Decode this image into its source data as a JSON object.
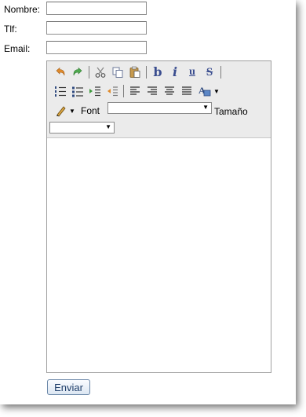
{
  "form": {
    "name_label": "Nombre:",
    "phone_label": "Tlf:",
    "email_label": "Email:",
    "name_value": "",
    "phone_value": "",
    "email_value": "",
    "submit_label": "Enviar"
  },
  "editor": {
    "font_label": "Font",
    "size_label": "Tamaño",
    "font_value": "",
    "size_value": "",
    "body_text": ""
  },
  "toolbar": {
    "bold_glyph": "b",
    "italic_glyph": "i",
    "underline_glyph": "u",
    "strike_glyph": "S",
    "text_color_glyph": "A",
    "icons": [
      "undo-icon",
      "redo-icon",
      "cut-icon",
      "copy-icon",
      "paste-icon",
      "bold-icon",
      "italic-icon",
      "underline-icon",
      "strikethrough-icon",
      "ordered-list-icon",
      "unordered-list-icon",
      "indent-icon",
      "outdent-icon",
      "align-left-icon",
      "align-right-icon",
      "align-center-icon",
      "justify-icon",
      "text-color-icon",
      "background-color-icon"
    ],
    "colors": {
      "accent": "#3a4d8f",
      "toolbar_bg": "#ebebeb",
      "undo": "#e08a2a",
      "redo": "#3f9b3f"
    }
  }
}
